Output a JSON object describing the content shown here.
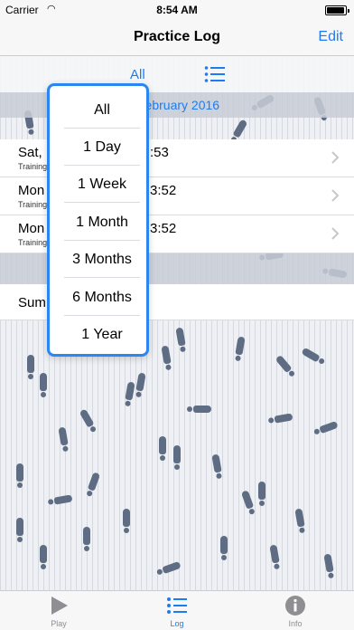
{
  "status_bar": {
    "carrier": "Carrier",
    "time": "8:54 AM"
  },
  "nav": {
    "title": "Practice Log",
    "edit_label": "Edit"
  },
  "filter": {
    "selected": "All",
    "list_icon": "list-icon"
  },
  "month_header": "February 2016",
  "rows": [
    {
      "title": "Sat,",
      "subtitle": "Training",
      "time": ":53"
    },
    {
      "title": "Mon",
      "subtitle": "Training",
      "time": "3:52"
    },
    {
      "title": "Mon",
      "subtitle": "Training",
      "time": "3:52"
    }
  ],
  "summary_label": "Sum",
  "popover_options": [
    "All",
    "1 Day",
    "1 Week",
    "1 Month",
    "3 Months",
    "6 Months",
    "1 Year"
  ],
  "tabs": [
    {
      "label": "Play",
      "icon": "play-icon"
    },
    {
      "label": "Log",
      "icon": "list-icon",
      "active": true
    },
    {
      "label": "Info",
      "icon": "info-icon"
    }
  ],
  "colors": {
    "accent": "#1e7cf2",
    "popover_border": "#2a86f0",
    "footprint": "#5f6d84"
  }
}
